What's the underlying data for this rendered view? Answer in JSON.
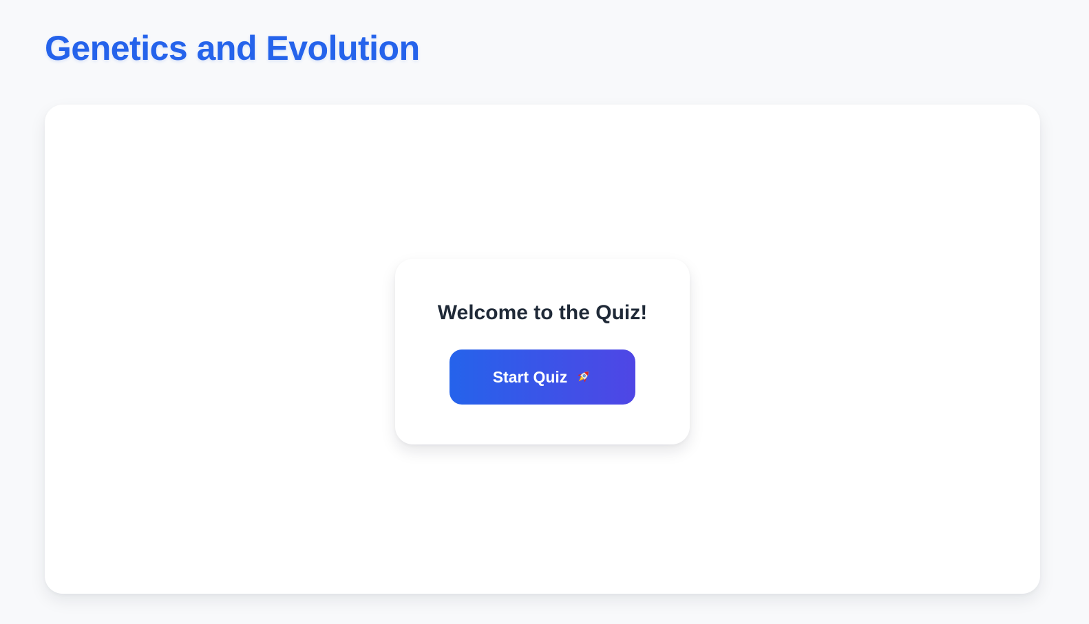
{
  "header": {
    "title": "Genetics and Evolution"
  },
  "welcome": {
    "heading": "Welcome to the Quiz!",
    "start_button_label": "Start Quiz",
    "start_button_icon": "rocket-icon"
  },
  "colors": {
    "accent": "#2563eb",
    "accent_secondary": "#4f46e5",
    "heading_text": "#1f2937",
    "page_background": "#f8f9fb",
    "panel_background": "#ffffff"
  }
}
